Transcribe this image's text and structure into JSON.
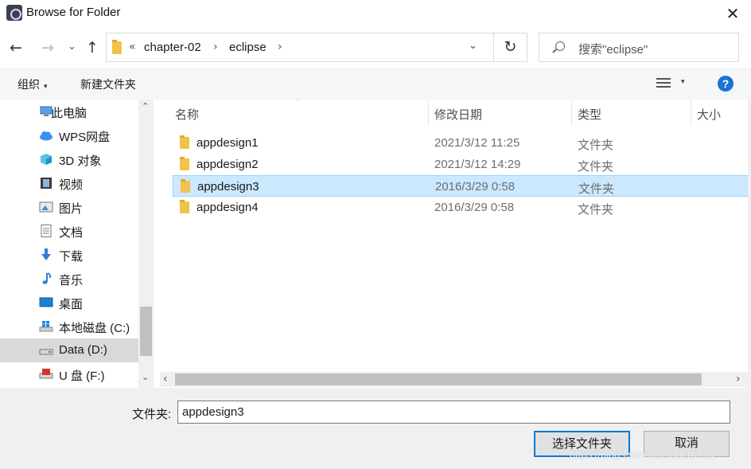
{
  "window": {
    "title": "Browse for Folder",
    "close_glyph": "✕"
  },
  "nav": {
    "back_glyph": "←",
    "forward_glyph": "→",
    "recent_glyph": "⌄",
    "up_glyph": "↑",
    "breadcrumb_overflow": "«",
    "breadcrumb": [
      "chapter-02",
      "eclipse"
    ],
    "breadcrumb_sep": "›",
    "address_dropdown_glyph": "⌄",
    "refresh_glyph": "↻",
    "search_placeholder": "搜索\"eclipse\""
  },
  "toolbar": {
    "organize_label": "组织",
    "organize_caret": "▾",
    "new_folder_label": "新建文件夹",
    "view_caret": "▾",
    "help_glyph": "?"
  },
  "sidebar": {
    "items": [
      {
        "label": "此电脑",
        "icon": "computer-icon"
      },
      {
        "label": "WPS网盘",
        "icon": "cloud-icon"
      },
      {
        "label": "3D 对象",
        "icon": "cube-icon"
      },
      {
        "label": "视频",
        "icon": "video-icon"
      },
      {
        "label": "图片",
        "icon": "picture-icon"
      },
      {
        "label": "文档",
        "icon": "document-icon"
      },
      {
        "label": "下载",
        "icon": "download-icon"
      },
      {
        "label": "音乐",
        "icon": "music-icon"
      },
      {
        "label": "桌面",
        "icon": "desktop-icon"
      },
      {
        "label": "本地磁盘 (C:)",
        "icon": "windows-drive-icon"
      },
      {
        "label": "Data (D:)",
        "icon": "drive-icon"
      },
      {
        "label": "U 盘 (F:)",
        "icon": "usb-drive-icon"
      }
    ],
    "selected_index": 10,
    "scroll_up": "⌃",
    "scroll_down": "⌄"
  },
  "files": {
    "columns": [
      "名称",
      "修改日期",
      "类型",
      "大小"
    ],
    "sort_caret": "⌃",
    "rows": [
      {
        "name": "appdesign1",
        "date": "2021/3/12 11:25",
        "type": "文件夹"
      },
      {
        "name": "appdesign2",
        "date": "2021/3/12 14:29",
        "type": "文件夹"
      },
      {
        "name": "appdesign3",
        "date": "2016/3/29 0:58",
        "type": "文件夹"
      },
      {
        "name": "appdesign4",
        "date": "2016/3/29 0:58",
        "type": "文件夹"
      }
    ],
    "selected_index": 2,
    "scroll_left": "‹",
    "scroll_right": "›"
  },
  "footer": {
    "folder_label": "文件夹:",
    "folder_value": "appdesign3",
    "ok_label": "选择文件夹",
    "cancel_label": "取消",
    "watermark": "https://blog.csdn.net/superfreak"
  },
  "colors": {
    "accent": "#0078d7",
    "selection": "#cce8ff",
    "folder": "#f1c34a"
  }
}
